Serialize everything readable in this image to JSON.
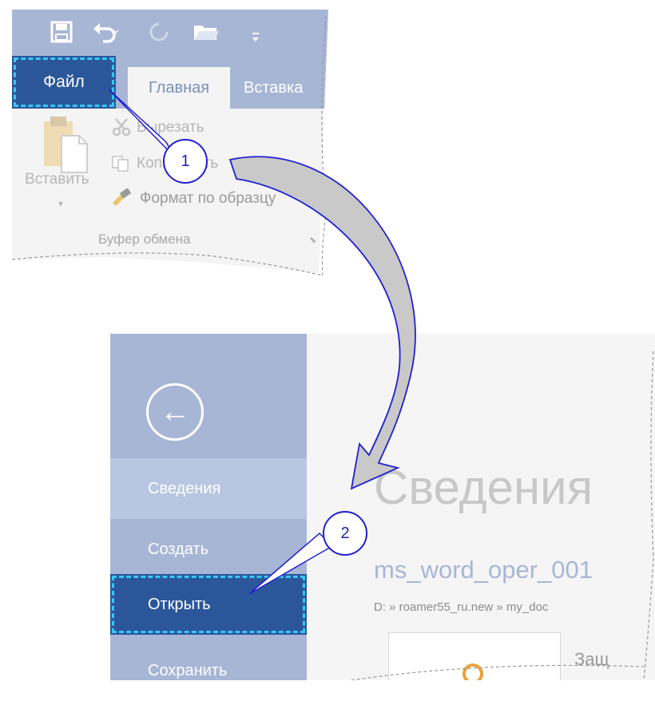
{
  "ribbon": {
    "qat_icons": [
      "save-icon",
      "undo-icon",
      "redo-icon",
      "open-folder-icon",
      "customize-arrow-icon"
    ],
    "tabs": {
      "file": "Файл",
      "home": "Главная",
      "insert": "Вставка"
    },
    "paste_label": "Вставить",
    "cut_label": "Вырезать",
    "copy_label": "Копировать",
    "format_painter_label": "Формат по образцу",
    "group_label": "Буфер обмена"
  },
  "backstage": {
    "back_glyph": "←",
    "menu": [
      "Сведения",
      "Создать",
      "Открыть",
      "Сохранить"
    ],
    "title": "Сведения",
    "doc_name": "ms_word_oper_001",
    "doc_path": "D: » roamer55_ru.new » my_doc",
    "card_text": "Защ"
  },
  "callouts": [
    "1",
    "2"
  ],
  "colors": {
    "accent": "#2b579a",
    "sidebar": "#a8b6d6",
    "highlight": "#37c6f4",
    "arrow": "#2020d0"
  }
}
